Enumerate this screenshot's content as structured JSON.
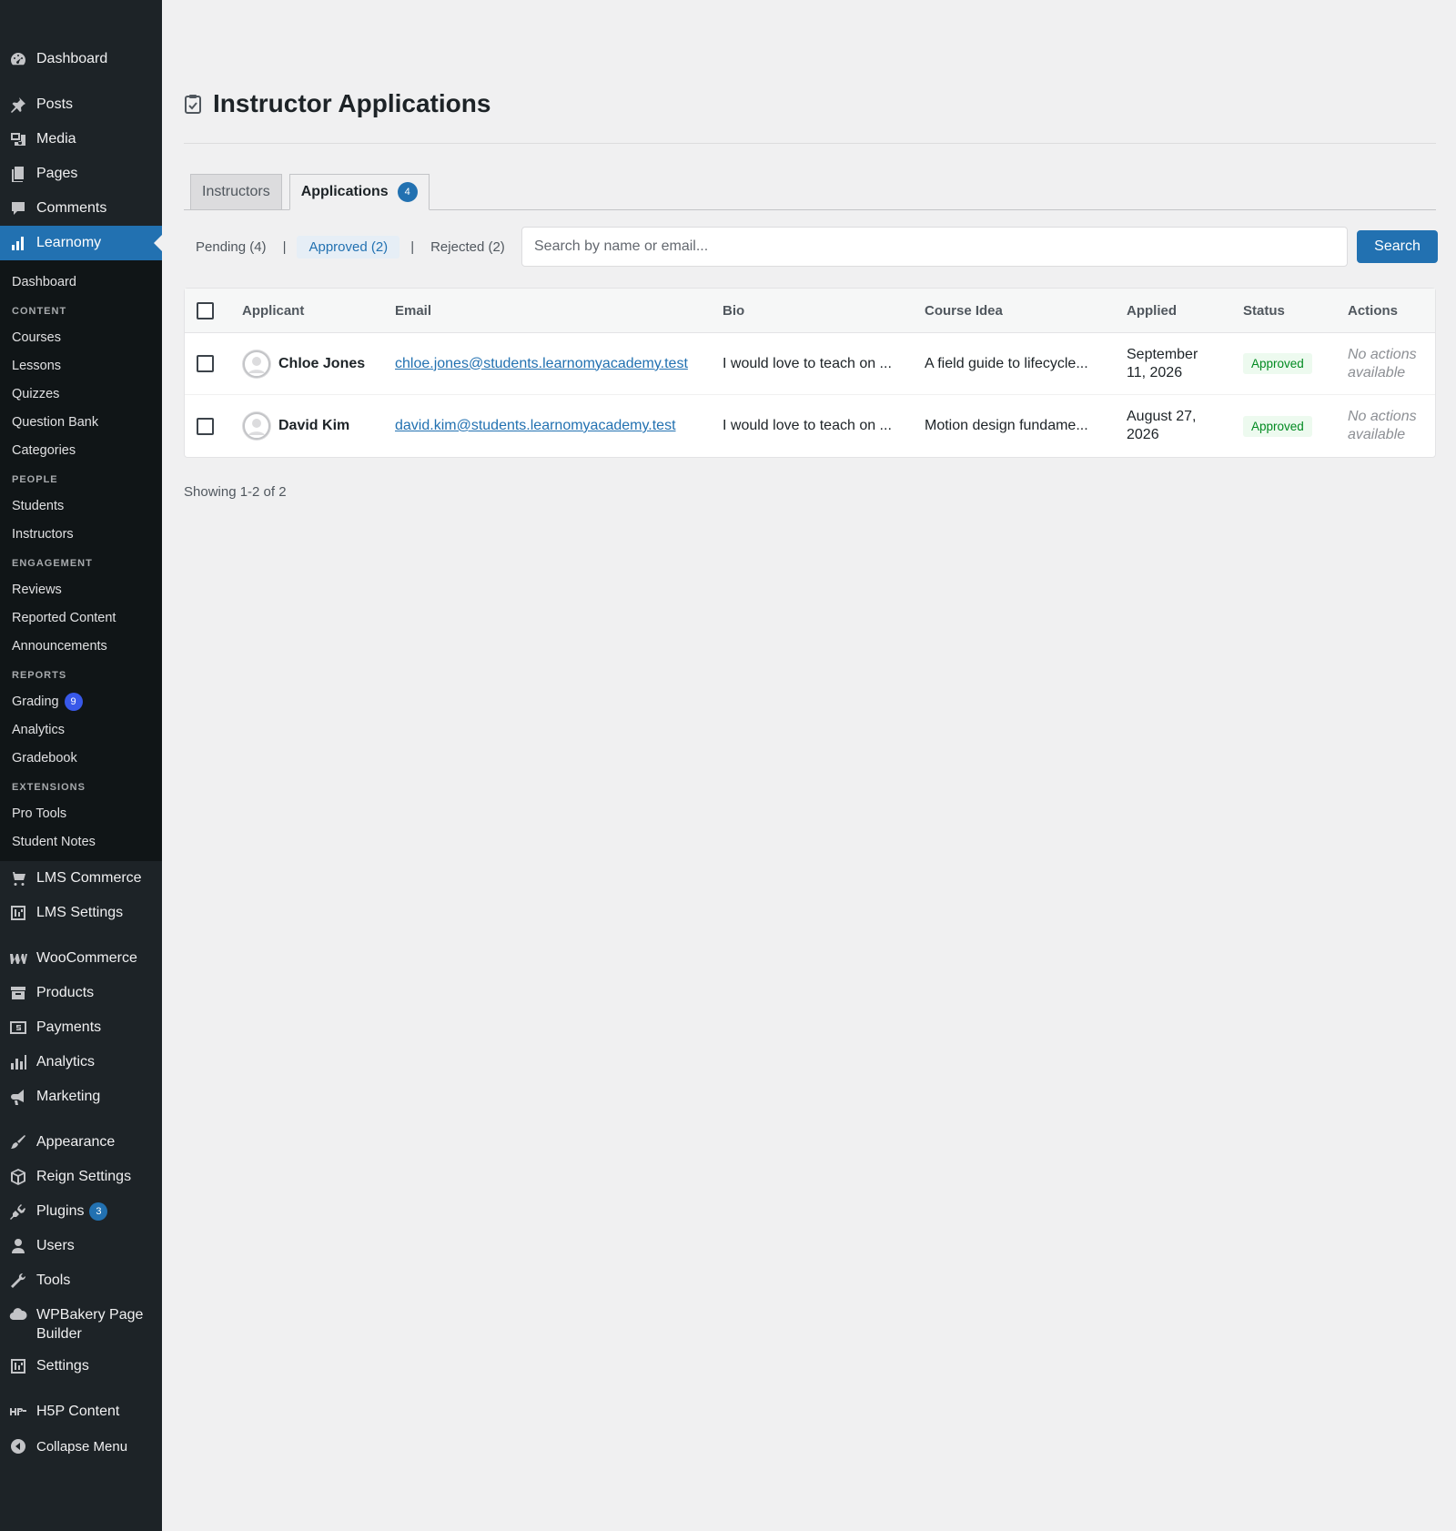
{
  "sidebar": {
    "top": [
      {
        "label": "Dashboard",
        "icon": "dashboard-icon"
      },
      {
        "label": "Posts",
        "icon": "pin-icon"
      },
      {
        "label": "Media",
        "icon": "media-icon"
      },
      {
        "label": "Pages",
        "icon": "pages-icon"
      },
      {
        "label": "Comments",
        "icon": "comments-icon"
      },
      {
        "label": "Learnomy",
        "icon": "bar-chart-icon"
      }
    ],
    "learnomy_sub": {
      "dashboard": "Dashboard",
      "content_heading": "CONTENT",
      "courses": "Courses",
      "lessons": "Lessons",
      "quizzes": "Quizzes",
      "question_bank": "Question Bank",
      "categories": "Categories",
      "people_heading": "PEOPLE",
      "students": "Students",
      "instructors": "Instructors",
      "engagement_heading": "ENGAGEMENT",
      "reviews": "Reviews",
      "reported_content": "Reported Content",
      "announcements": "Announcements",
      "reports_heading": "REPORTS",
      "grading": "Grading",
      "grading_badge": "9",
      "analytics": "Analytics",
      "gradebook": "Gradebook",
      "extensions_heading": "EXTENSIONS",
      "pro_tools": "Pro Tools",
      "student_notes": "Student Notes"
    },
    "lower": {
      "lms_commerce": "LMS Commerce",
      "lms_settings": "LMS Settings",
      "woocommerce": "WooCommerce",
      "products": "Products",
      "payments": "Payments",
      "analytics": "Analytics",
      "marketing": "Marketing",
      "appearance": "Appearance",
      "reign_settings": "Reign Settings",
      "plugins": "Plugins",
      "plugins_badge": "3",
      "users": "Users",
      "tools": "Tools",
      "wpbakery_line1": "WPBakery Page",
      "wpbakery_line2": "Builder",
      "settings": "Settings",
      "h5p": "H5P Content",
      "collapse": "Collapse Menu"
    },
    "active_color": "#2271b1"
  },
  "page": {
    "title": "Instructor Applications",
    "tabs": {
      "instructors": "Instructors",
      "applications": "Applications",
      "applications_badge": "4"
    },
    "filters": {
      "pending": "Pending (4)",
      "approved": "Approved (2)",
      "rejected": "Rejected (2)",
      "separator": "|"
    },
    "search": {
      "placeholder": "Search by name or email...",
      "button": "Search"
    },
    "table": {
      "headers": {
        "applicant": "Applicant",
        "email": "Email",
        "bio": "Bio",
        "course_idea": "Course Idea",
        "applied": "Applied",
        "status": "Status",
        "actions": "Actions"
      },
      "rows": [
        {
          "name": "Chloe Jones",
          "email": "chloe.jones@students.learnomyacademy.test",
          "bio": "I would love to teach on ...",
          "course_idea": "A field guide to lifecycle...",
          "applied_1": "September",
          "applied_2": "11, 2026",
          "status": "Approved",
          "actions_1": "No actions",
          "actions_2": "available"
        },
        {
          "name": "David Kim",
          "email": "david.kim@students.learnomyacademy.test",
          "bio": "I would love to teach on ...",
          "course_idea": "Motion design fundame...",
          "applied_1": "August 27,",
          "applied_2": "2026",
          "status": "Approved",
          "actions_1": "No actions",
          "actions_2": "available"
        }
      ]
    },
    "showing": "Showing 1-2 of 2"
  }
}
